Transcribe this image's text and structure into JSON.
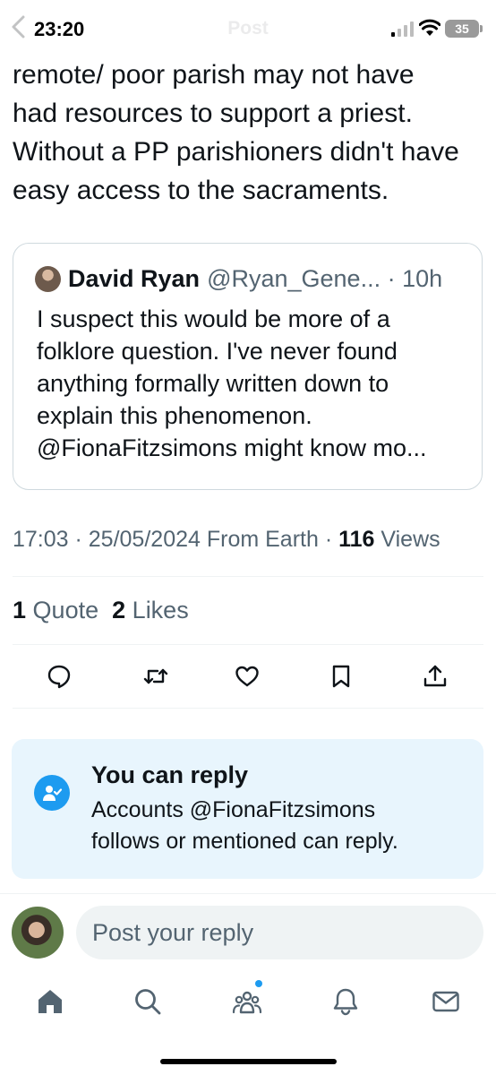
{
  "status": {
    "time": "23:20",
    "battery": "35"
  },
  "header": {
    "title": "Post"
  },
  "post": {
    "lines": [
      "remote/ poor parish may not have",
      "had resources to support a priest.",
      "Without a PP parishioners didn't have",
      "easy access to the sacraments."
    ],
    "timestamp": "17:03 · 25/05/2024 From Earth · ",
    "views_count": "116",
    "views_label": " Views"
  },
  "quote": {
    "name": "David Ryan",
    "handle": "@Ryan_Gene... · 10h",
    "lines": [
      "I suspect this would be more of a",
      "folklore question. I've never found",
      "anything formally written down to",
      "explain this phenomenon.",
      "@FionaFitzsimons might know mo..."
    ]
  },
  "stats": {
    "quotes_count": "1",
    "quotes_label": "Quote",
    "likes_count": "2",
    "likes_label": "Likes"
  },
  "actions": [
    "reply-icon",
    "repost-icon",
    "like-icon",
    "bookmark-icon",
    "share-icon"
  ],
  "reply_info": {
    "title": "You can reply",
    "line1": "Accounts @FionaFitzsimons",
    "line2": "follows or mentioned can reply."
  },
  "composer": {
    "placeholder": "Post your reply"
  },
  "tabs": [
    "home-icon",
    "search-icon",
    "communities-icon",
    "notifications-icon",
    "messages-icon"
  ],
  "colors": {
    "accent": "#1d9bf0",
    "text": "#0f1419",
    "muted": "#536471",
    "reply_bg": "#e8f5fd"
  }
}
